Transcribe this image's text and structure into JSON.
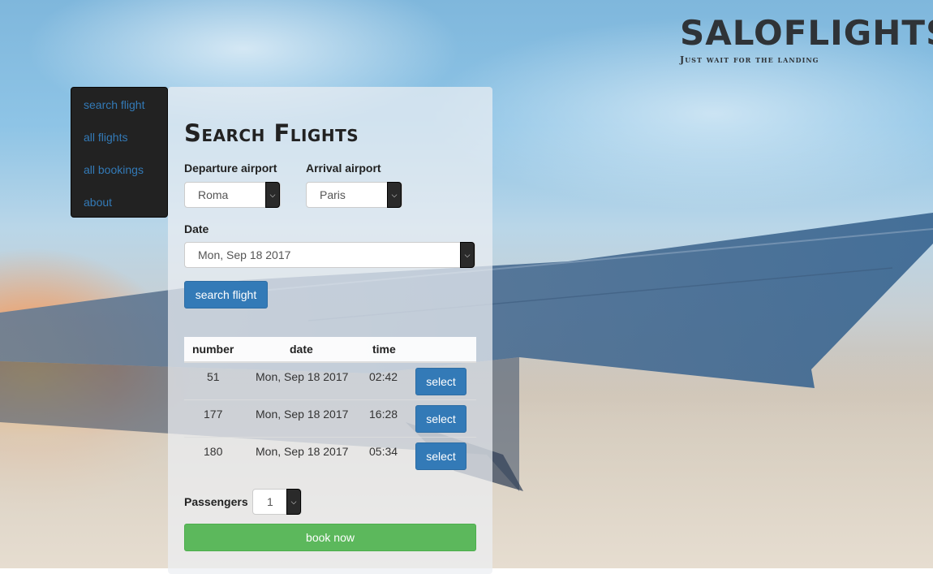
{
  "brand": {
    "title": "SALOFLIGHTS",
    "tagline": "Just wait for the landing"
  },
  "nav": {
    "items": [
      {
        "label": "search flight"
      },
      {
        "label": "all flights"
      },
      {
        "label": "all bookings"
      },
      {
        "label": "about"
      }
    ]
  },
  "search": {
    "title": "Search Flights",
    "departure_label": "Departure airport",
    "departure_value": "Roma",
    "arrival_label": "Arrival airport",
    "arrival_value": "Paris",
    "date_label": "Date",
    "date_value": "Mon, Sep 18 2017",
    "search_button": "search flight"
  },
  "results": {
    "columns": [
      "number",
      "date",
      "time"
    ],
    "rows": [
      {
        "number": "51",
        "date": "Mon, Sep 18 2017",
        "time": "02:42",
        "action": "select"
      },
      {
        "number": "177",
        "date": "Mon, Sep 18 2017",
        "time": "16:28",
        "action": "select"
      },
      {
        "number": "180",
        "date": "Mon, Sep 18 2017",
        "time": "05:34",
        "action": "select"
      }
    ]
  },
  "booking": {
    "passengers_label": "Passengers",
    "passengers_value": "1",
    "book_button": "book now"
  },
  "colors": {
    "primary": "#337ab7",
    "success": "#5cb85c",
    "nav_bg": "#222222"
  },
  "icons": {
    "dropdown": "chevron-down-icon"
  }
}
